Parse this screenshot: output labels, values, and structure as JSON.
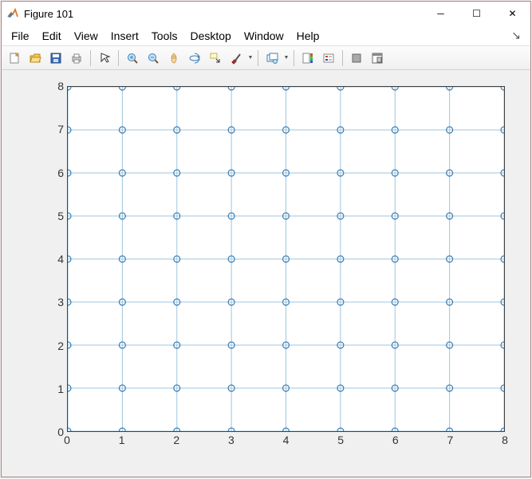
{
  "window": {
    "title": "Figure 101",
    "minimize": "─",
    "maximize": "☐",
    "close": "✕"
  },
  "menu": {
    "items": [
      "File",
      "Edit",
      "View",
      "Insert",
      "Tools",
      "Desktop",
      "Window",
      "Help"
    ]
  },
  "toolbar": {
    "groups": [
      [
        "new-figure",
        "open",
        "save",
        "print"
      ],
      [
        "pointer"
      ],
      [
        "zoom-in",
        "zoom-out",
        "pan",
        "rotate3d",
        "data-cursor",
        "brush"
      ],
      [
        "link-plots"
      ],
      [
        "colorbar",
        "legend"
      ],
      [
        "hide-tools",
        "dock"
      ]
    ]
  },
  "chart_data": {
    "type": "scatter",
    "title": "",
    "xlabel": "",
    "ylabel": "",
    "xlim": [
      0,
      8
    ],
    "ylim": [
      0,
      8
    ],
    "xticks": [
      0,
      1,
      2,
      3,
      4,
      5,
      6,
      7,
      8
    ],
    "yticks": [
      0,
      1,
      2,
      3,
      4,
      5,
      6,
      7,
      8
    ],
    "grid": true,
    "marker": "o",
    "color": "#3b7fb5",
    "x": [
      0,
      1,
      2,
      3,
      4,
      5,
      6,
      7,
      8,
      0,
      1,
      2,
      3,
      4,
      5,
      6,
      7,
      8,
      0,
      1,
      2,
      3,
      4,
      5,
      6,
      7,
      8,
      0,
      1,
      2,
      3,
      4,
      5,
      6,
      7,
      8,
      0,
      1,
      2,
      3,
      4,
      5,
      6,
      7,
      8,
      0,
      1,
      2,
      3,
      4,
      5,
      6,
      7,
      8,
      0,
      1,
      2,
      3,
      4,
      5,
      6,
      7,
      8,
      0,
      1,
      2,
      3,
      4,
      5,
      6,
      7,
      8,
      0,
      1,
      2,
      3,
      4,
      5,
      6,
      7,
      8
    ],
    "y": [
      0,
      0,
      0,
      0,
      0,
      0,
      0,
      0,
      0,
      1,
      1,
      1,
      1,
      1,
      1,
      1,
      1,
      1,
      2,
      2,
      2,
      2,
      2,
      2,
      2,
      2,
      2,
      3,
      3,
      3,
      3,
      3,
      3,
      3,
      3,
      3,
      4,
      4,
      4,
      4,
      4,
      4,
      4,
      4,
      4,
      5,
      5,
      5,
      5,
      5,
      5,
      5,
      5,
      5,
      6,
      6,
      6,
      6,
      6,
      6,
      6,
      6,
      6,
      7,
      7,
      7,
      7,
      7,
      7,
      7,
      7,
      7,
      8,
      8,
      8,
      8,
      8,
      8,
      8,
      8,
      8
    ]
  }
}
